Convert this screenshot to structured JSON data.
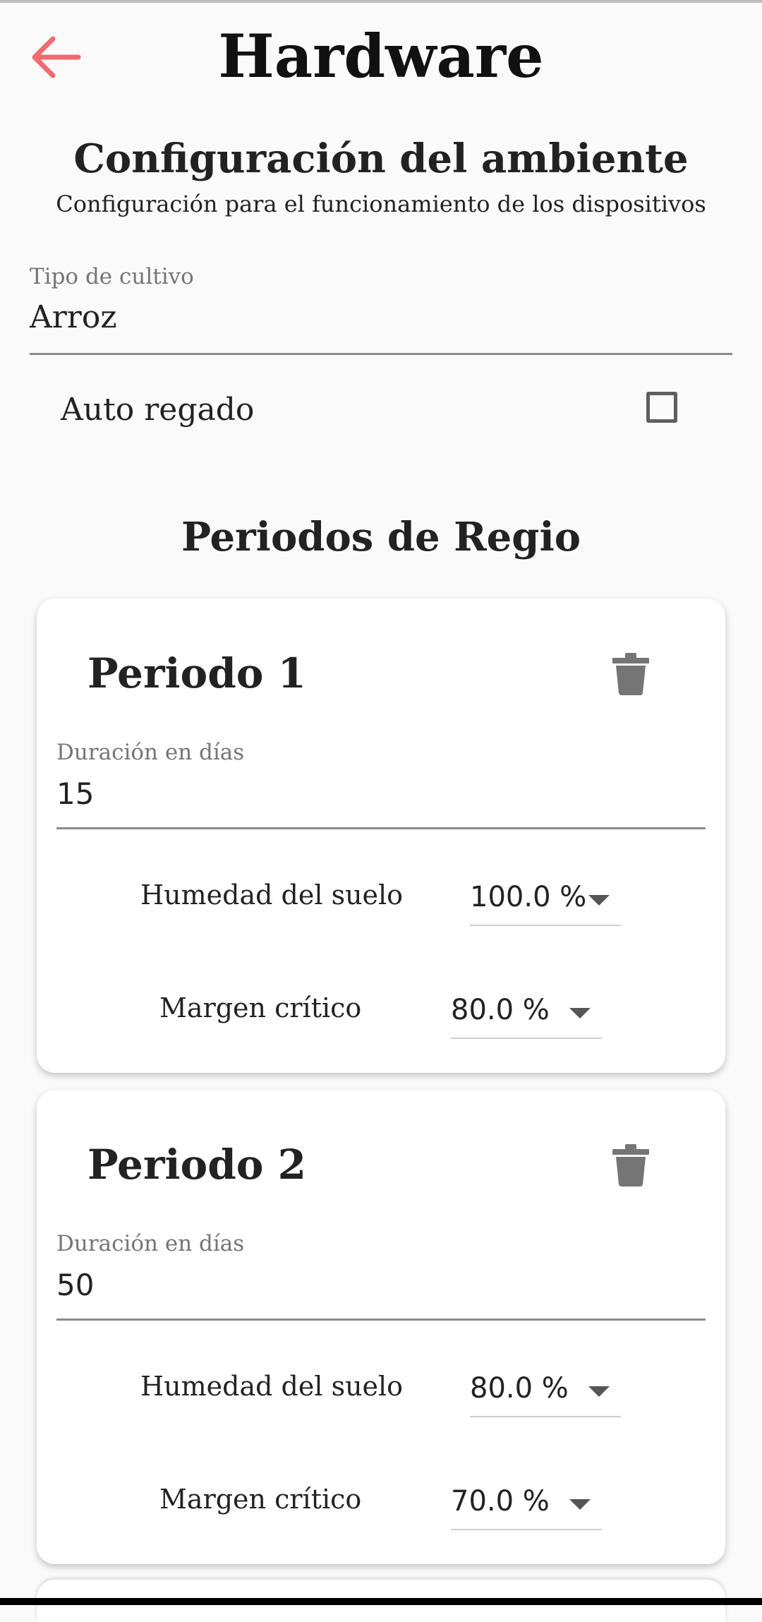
{
  "header": {
    "title": "Hardware",
    "back_icon": "arrow-left-icon",
    "accent": "#f06a6f"
  },
  "environment": {
    "title": "Configuración del ambiente",
    "subtitle": "Configuración para el funcionamiento de los dispositivos",
    "crop_type": {
      "label": "Tipo de cultivo",
      "value": "Arroz"
    },
    "auto_irrigation": {
      "label": "Auto regado",
      "checked": false
    }
  },
  "periods": {
    "title": "Periodos de Regio",
    "items": [
      {
        "title": "Periodo 1",
        "duration_label": "Duración en días",
        "duration_value": "15",
        "humidity_label": "Humedad del suelo",
        "humidity_value": "100.0 %",
        "margin_label": "Margen crítico",
        "margin_value": "80.0 %"
      },
      {
        "title": "Periodo 2",
        "duration_label": "Duración en días",
        "duration_value": "50",
        "humidity_label": "Humedad del suelo",
        "humidity_value": "80.0 %",
        "margin_label": "Margen crítico",
        "margin_value": "70.0 %"
      }
    ]
  }
}
